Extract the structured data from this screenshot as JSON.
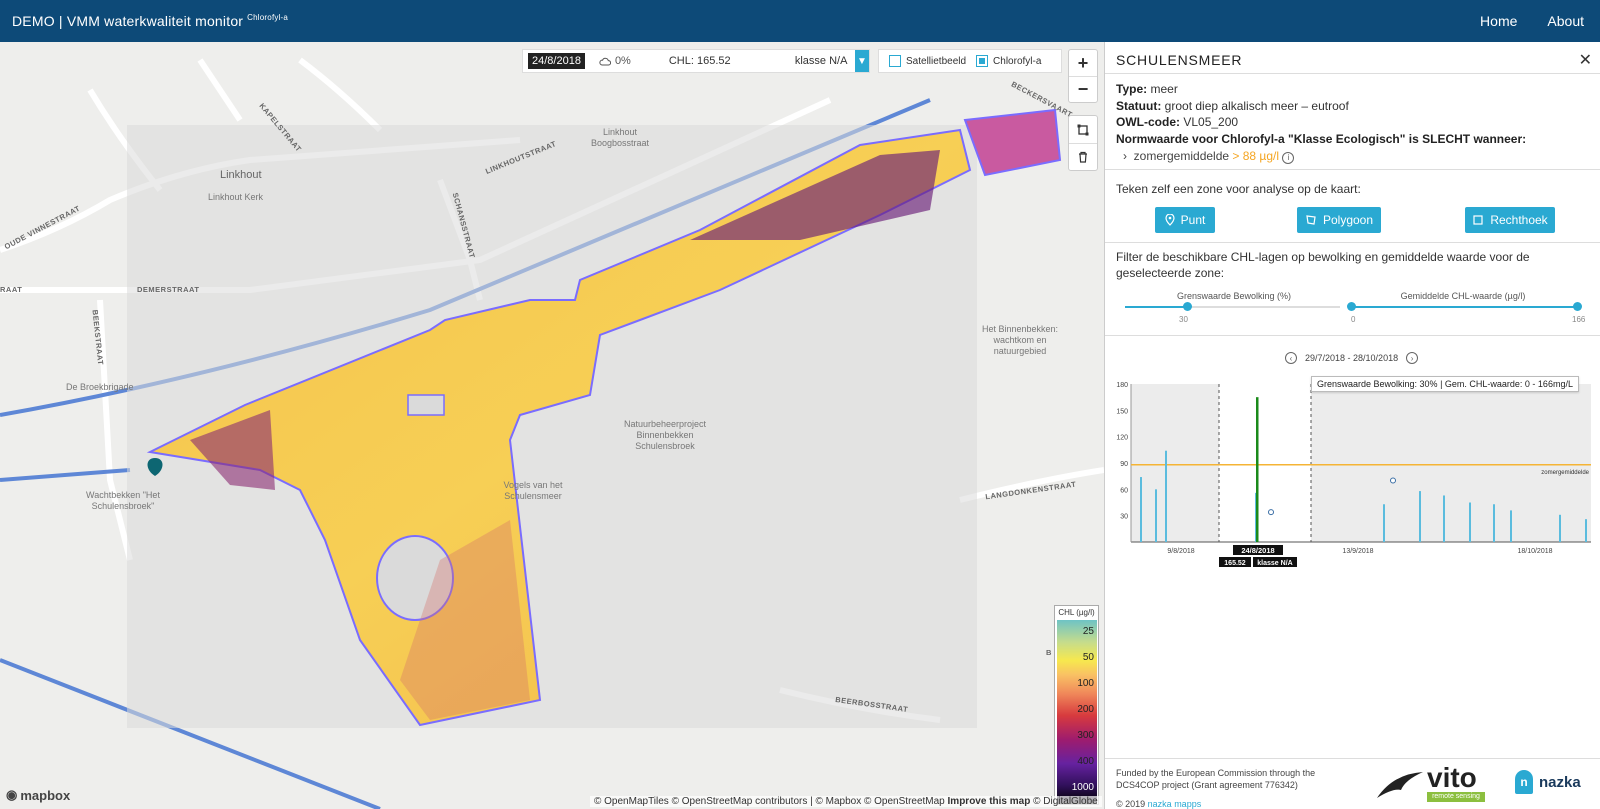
{
  "header": {
    "title": "DEMO | VMM waterkwaliteit monitor",
    "subtitle": "Chlorofyl-a",
    "nav": [
      "Home",
      "About"
    ]
  },
  "infobar": {
    "date": "24/8/2018",
    "cloud": "0%",
    "chl": "CHL: 165.52",
    "klasse": "klasse N/A"
  },
  "layers": {
    "satelliet": "Satellietbeeld",
    "chlorofyl": "Chlorofyl-a"
  },
  "map_labels": {
    "linkhout": "Linkhout",
    "linkhout_kerk": "Linkhout Kerk",
    "linkhout_boog": "Linkhout Boogbosstraat",
    "linkhoutstraat": "LINKHOUTSTRAAT",
    "kapelstraat": "KAPELSTRAAT",
    "schansstraat": "SCHANSSTRAAT",
    "oude_vinne": "OUDE VINNESTRAAT",
    "demerstraat": "DEMERSTRAAT",
    "beekstraat": "BEEKSTRAAT",
    "raat": "RAAT",
    "broekbrigade": "De Broekbrigade",
    "wachtbekken": "Wachtbekken \"Het Schulensbroek\"",
    "natuurbeheer": "Natuurbeheerproject Binnenbekken Schulensbroek",
    "vogels": "Vogels van het Schulensmeer",
    "binnenbekken": "Het Binnenbekken: wachtkom en natuurgebied",
    "langdonken": "LANGDONKENSTRAAT",
    "beerbos": "BEERBOSSTRAAT",
    "beckersvaart": "BECKERSVAART",
    "b": "B"
  },
  "legend": {
    "title": "CHL (µg/l)",
    "ticks": [
      "25",
      "50",
      "100",
      "200",
      "300",
      "400",
      "1000"
    ]
  },
  "attribution": {
    "text": "© OpenMapTiles © OpenStreetMap contributors | © Mapbox © OpenStreetMap",
    "improve": "Improve this map",
    "rest": "© DigitalGlobe"
  },
  "mapbox": "mapbox",
  "panel": {
    "title": "SCHULENSMEER",
    "type_label": "Type:",
    "type_value": "meer",
    "statuut_label": "Statuut:",
    "statuut_value": "groot diep alkalisch meer – eutroof",
    "owl_label": "OWL-code:",
    "owl_value": "VL05_200",
    "norm": "Normwaarde voor Chlorofyl-a \"Klasse Ecologisch\" is SLECHT wanneer:",
    "norm_item": "zomergemiddelde",
    "norm_value": "> 88 µg/l",
    "draw_title": "Teken zelf een zone voor analyse op de kaart:",
    "buttons": [
      "Punt",
      "Polygoon",
      "Rechthoek"
    ],
    "filter_text": "Filter de beschikbare CHL-lagen op bewolking en gemiddelde waarde voor de geselecteerde zone:",
    "slider1": {
      "label": "Grenswaarde Bewolking (%)",
      "value": "30"
    },
    "slider2": {
      "label": "Gemiddelde CHL-waarde (µg/l)",
      "min": "0",
      "max": "166"
    },
    "range": "29/7/2018 - 28/10/2018",
    "tooltip": "Grenswaarde Bewolking: 30% | Gem. CHL-waarde: 0 - 166mg/L",
    "footer": "Funded by the European Commission through the DCS4COP project (Grant agreement 776342)",
    "copyright": "© 2019",
    "copyright_link": "nazka mapps",
    "vito": "vito",
    "vito_sub": "remote sensing",
    "nazka": "nazka"
  },
  "chart_data": {
    "type": "bar",
    "ylim": [
      0,
      180
    ],
    "yticks": [
      "180",
      "150",
      "120",
      "90",
      "60",
      "30"
    ],
    "xticks": [
      "9/8/2018",
      "13/9/2018",
      "18/10/2018"
    ],
    "threshold": 88,
    "threshold_label": "zomergemiddelde",
    "selected": {
      "date": "24/8/2018",
      "value": "165.52",
      "klasse": "klasse N/A"
    },
    "bars": [
      74,
      60,
      104,
      165,
      56,
      43,
      58,
      53,
      45,
      43,
      36,
      31,
      26
    ],
    "points": [
      34,
      70
    ],
    "colors": {
      "bar": "#5bbcde",
      "selected": "#1a8a1a",
      "threshold": "#f5b435",
      "shade": "#ececec"
    }
  }
}
